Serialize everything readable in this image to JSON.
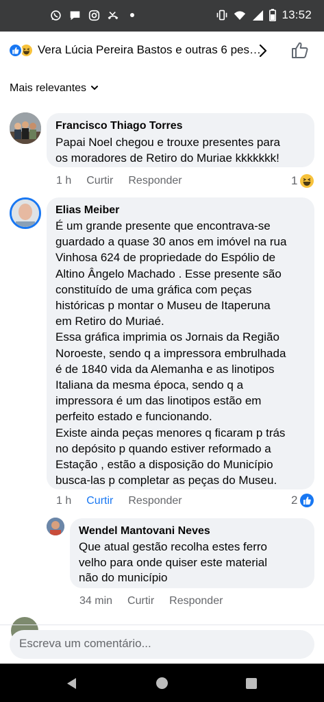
{
  "status_bar": {
    "time": "13:52",
    "left_icons": [
      "whatsapp-icon",
      "chat-icon",
      "instagram-icon",
      "missed-call-icon",
      "dot-icon"
    ],
    "right_icons": [
      "vibrate-icon",
      "wifi-icon",
      "signal-icon",
      "battery-icon"
    ]
  },
  "reactions_header": {
    "text": "Vera Lúcia Pereira Bastos e outras 6 pes…",
    "icons": [
      "like-reaction-icon",
      "haha-reaction-icon"
    ],
    "colors": {
      "like": "#1877f2",
      "haha": "#f7c23c"
    }
  },
  "sort": {
    "label": "Mais relevantes"
  },
  "comments": [
    {
      "author": "Francisco Thiago Torres",
      "text": "Papai Noel chegou e trouxe presentes para\nos moradores de Retiro do Muriae kkkkkkk!",
      "time": "1 h",
      "like_label": "Curtir",
      "reply_label": "Responder",
      "reaction_count": "1",
      "reaction_icon": "haha-reaction-icon"
    },
    {
      "author": "Elias Meiber",
      "text": "É um grande presente que encontrava-se\nguardado a quase 30 anos em imóvel na rua\nVinhosa 624 de propriedade do Espólio de\nAltino Ângelo Machado . Esse presente são\nconstituído de uma gráfica com peças\nhistóricas p montar o Museu de Itaperuna\nem Retiro do Muriaé.\nEssa gráfica imprimia os Jornais da Região\nNoroeste, sendo q a impressora embrulhada\né de 1840 vida da Alemanha e as linotipos\nItaliana da mesma época, sendo q a\nimpressora é um das linotipos estão em\nperfeito estado e funcionando.\nExiste ainda peças menores q ficaram p trás\nno depósito p quando estiver reformado a\nEstação , estão a disposição do Município\nbusca-las p completar as peças do Museu.",
      "time": "1 h",
      "like_label": "Curtir",
      "reply_label": "Responder",
      "liked": true,
      "reaction_count": "2",
      "reaction_icon": "like-reaction-icon"
    }
  ],
  "reply": {
    "author": "Wendel Mantovani Neves",
    "text": "Que atual gestão recolha estes ferro\nvelho  para onde quiser este material\nnão do município",
    "time": "34 min",
    "like_label": "Curtir",
    "reply_label": "Responder"
  },
  "composer": {
    "placeholder": "Escreva um comentário..."
  },
  "nav_bar": {
    "icons": [
      "back-icon",
      "home-icon",
      "recents-icon"
    ]
  }
}
